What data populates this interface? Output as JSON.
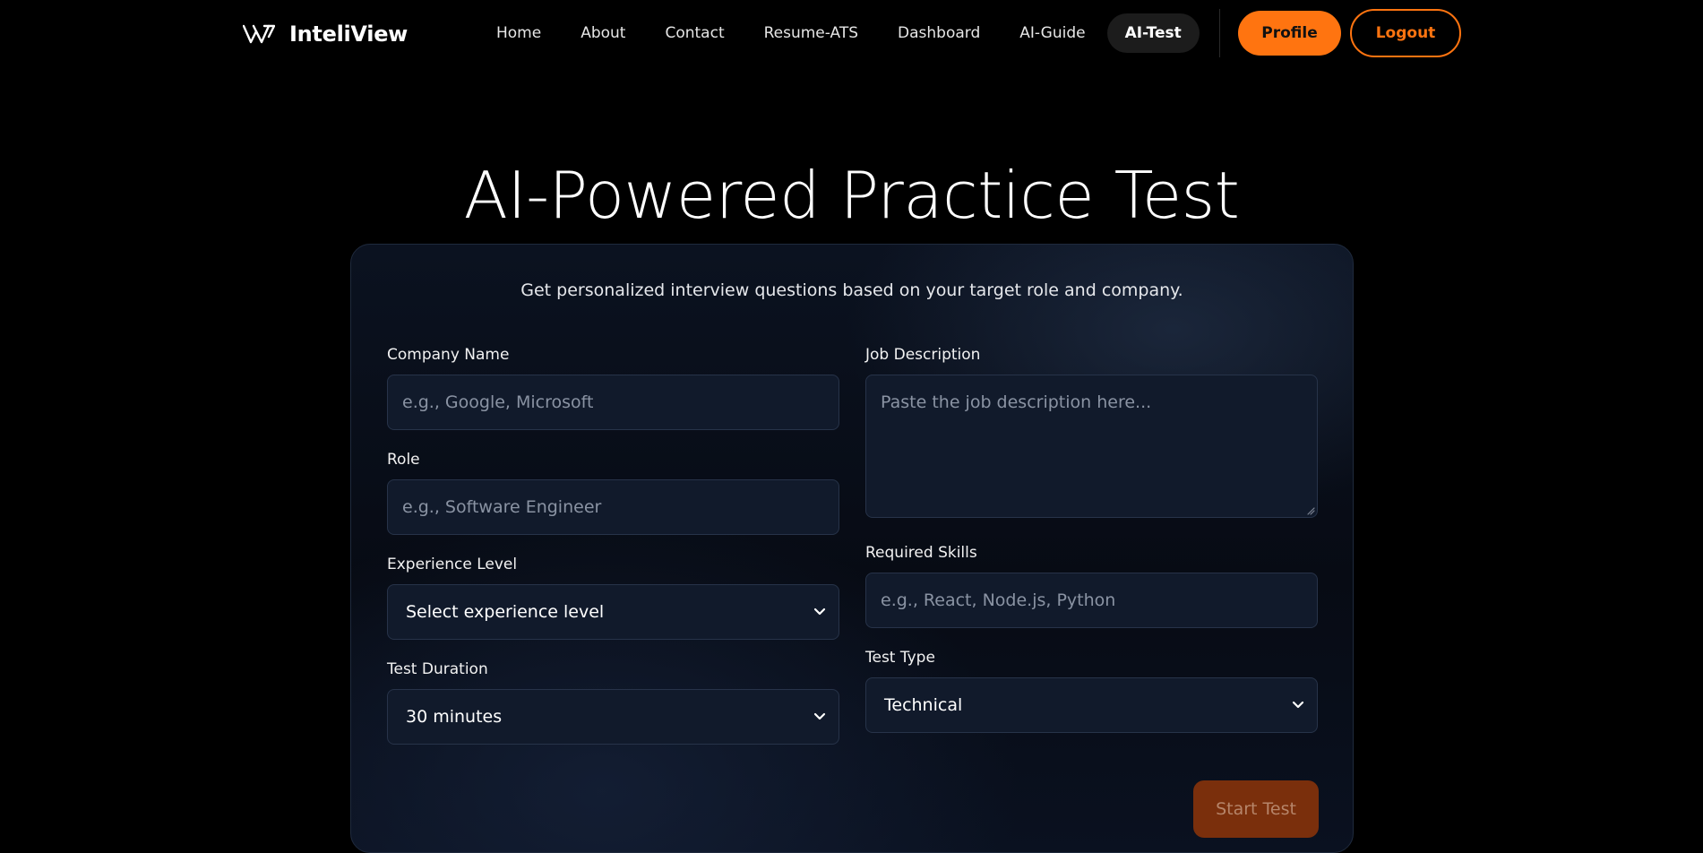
{
  "app": {
    "brand_name": "InteliView"
  },
  "nav": {
    "links": [
      {
        "label": "Home",
        "active": false
      },
      {
        "label": "About",
        "active": false
      },
      {
        "label": "Contact",
        "active": false
      },
      {
        "label": "Resume-ATS",
        "active": false
      },
      {
        "label": "Dashboard",
        "active": false
      },
      {
        "label": "AI-Guide",
        "active": false
      },
      {
        "label": "AI-Test",
        "active": true
      }
    ],
    "profile_label": "Profile",
    "logout_label": "Logout"
  },
  "page": {
    "title": "AI-Powered Practice Test",
    "subtitle": "Get personalized interview questions based on your target role and company."
  },
  "form": {
    "company": {
      "label": "Company Name",
      "placeholder": "e.g., Google, Microsoft",
      "value": ""
    },
    "role": {
      "label": "Role",
      "placeholder": "e.g., Software Engineer",
      "value": ""
    },
    "experience": {
      "label": "Experience Level",
      "selected": "Select experience level"
    },
    "duration": {
      "label": "Test Duration",
      "selected": "30 minutes"
    },
    "job_description": {
      "label": "Job Description",
      "placeholder": "Paste the job description here...",
      "value": ""
    },
    "skills": {
      "label": "Required Skills",
      "placeholder": "e.g., React, Node.js, Python",
      "value": ""
    },
    "test_type": {
      "label": "Test Type",
      "selected": "Technical"
    },
    "submit_label": "Start Test"
  },
  "colors": {
    "accent": "#ff7410",
    "page_background": "#000000",
    "card_background": "#0b1220",
    "input_background": "#111a2b",
    "submit_disabled": "#7a2f0c"
  },
  "icons": {
    "brand": "logo-w-icon",
    "select_arrow": "chevron-down-icon"
  }
}
